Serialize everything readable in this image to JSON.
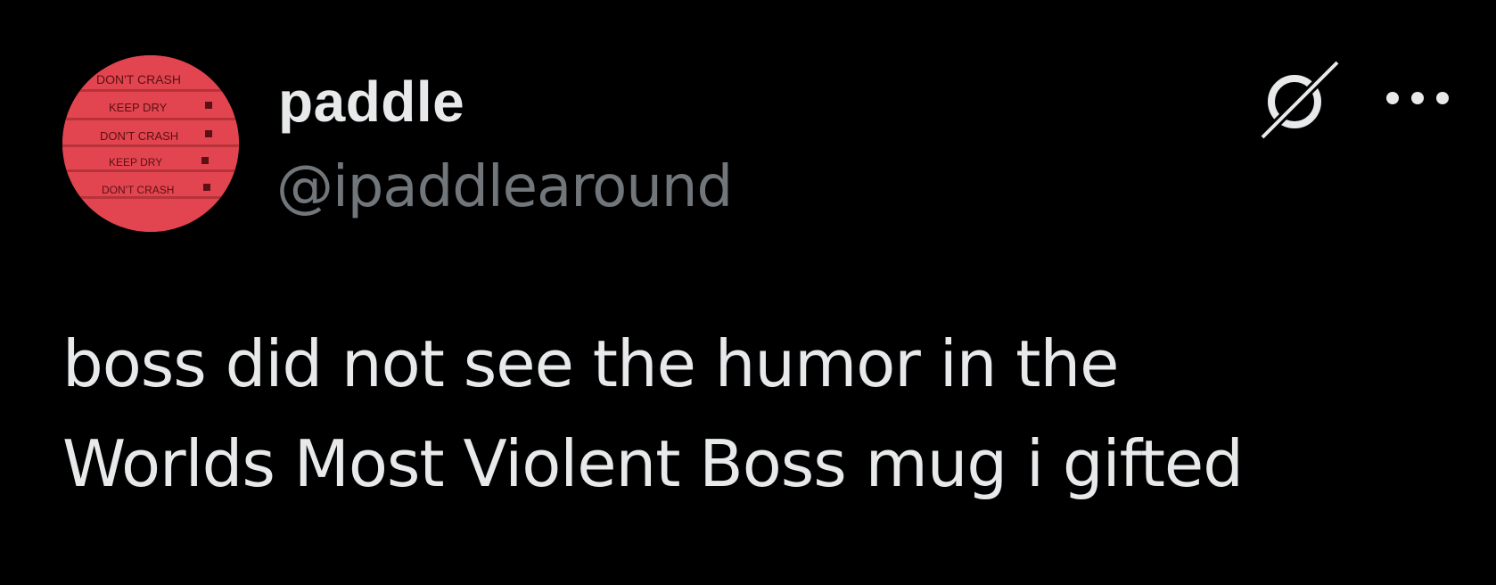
{
  "author": {
    "display_name": "paddle",
    "handle": "@ipaddlearound",
    "avatar": {
      "description_lines": [
        "DON'T CRASH",
        "KEEP DRY",
        "DON'T CRASH",
        "KEEP DRY",
        "DON'T CRASH"
      ],
      "background_color": "#e2454f"
    }
  },
  "actions": {
    "grok_icon": "grok-icon",
    "more_icon": "more-icon"
  },
  "tweet": {
    "lines": [
      "boss did not see the humor in the",
      "Worlds Most Violent Boss mug i gifted"
    ]
  },
  "colors": {
    "background": "#000000",
    "primary_text": "#e7e9ea",
    "secondary_text": "#71767b"
  }
}
